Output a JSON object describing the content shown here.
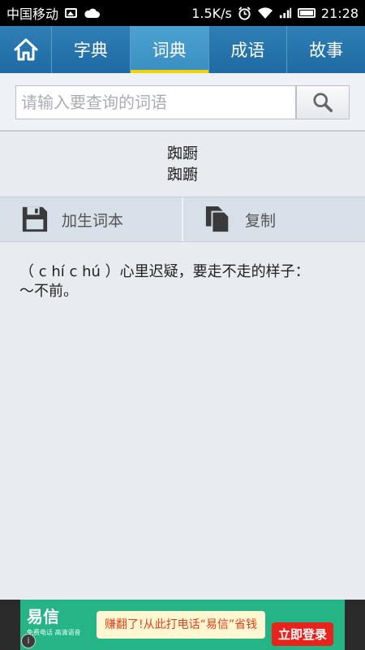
{
  "status_bar": {
    "carrier": "中国移动",
    "speed": "1.5K/s",
    "time": "21:28"
  },
  "tabs": [
    {
      "label": "字典"
    },
    {
      "label": "词典"
    },
    {
      "label": "成语"
    },
    {
      "label": "故事"
    }
  ],
  "search": {
    "placeholder": "请输入要查询的词语",
    "value": ""
  },
  "entry": {
    "word_simplified": "踟蹰",
    "word_traditional": "踟躕",
    "definition": "（ c hí c hú ）心里迟疑，要走不走的样子：～不前。"
  },
  "actions": {
    "add_wordbook_label": "加生词本",
    "copy_label": "复制"
  },
  "ad": {
    "brand": "易信",
    "brand_sub": "免费电话 高清语音",
    "slogan": "赚翻了!从此打电话“易信”省钱",
    "cta": "立即登录",
    "info": "i"
  },
  "colors": {
    "tab_bar": "#1f6aa3",
    "tab_active": "#3a8fc3",
    "tab_indicator": "#f3d200",
    "page_bg": "#e8ecf1",
    "ad_green": "#25b486"
  },
  "icons": [
    "home-icon",
    "search-icon",
    "save-icon",
    "copy-icon",
    "image-icon",
    "cloud-icon",
    "alarm-icon",
    "wifi-icon",
    "signal-icon",
    "battery-icon"
  ]
}
